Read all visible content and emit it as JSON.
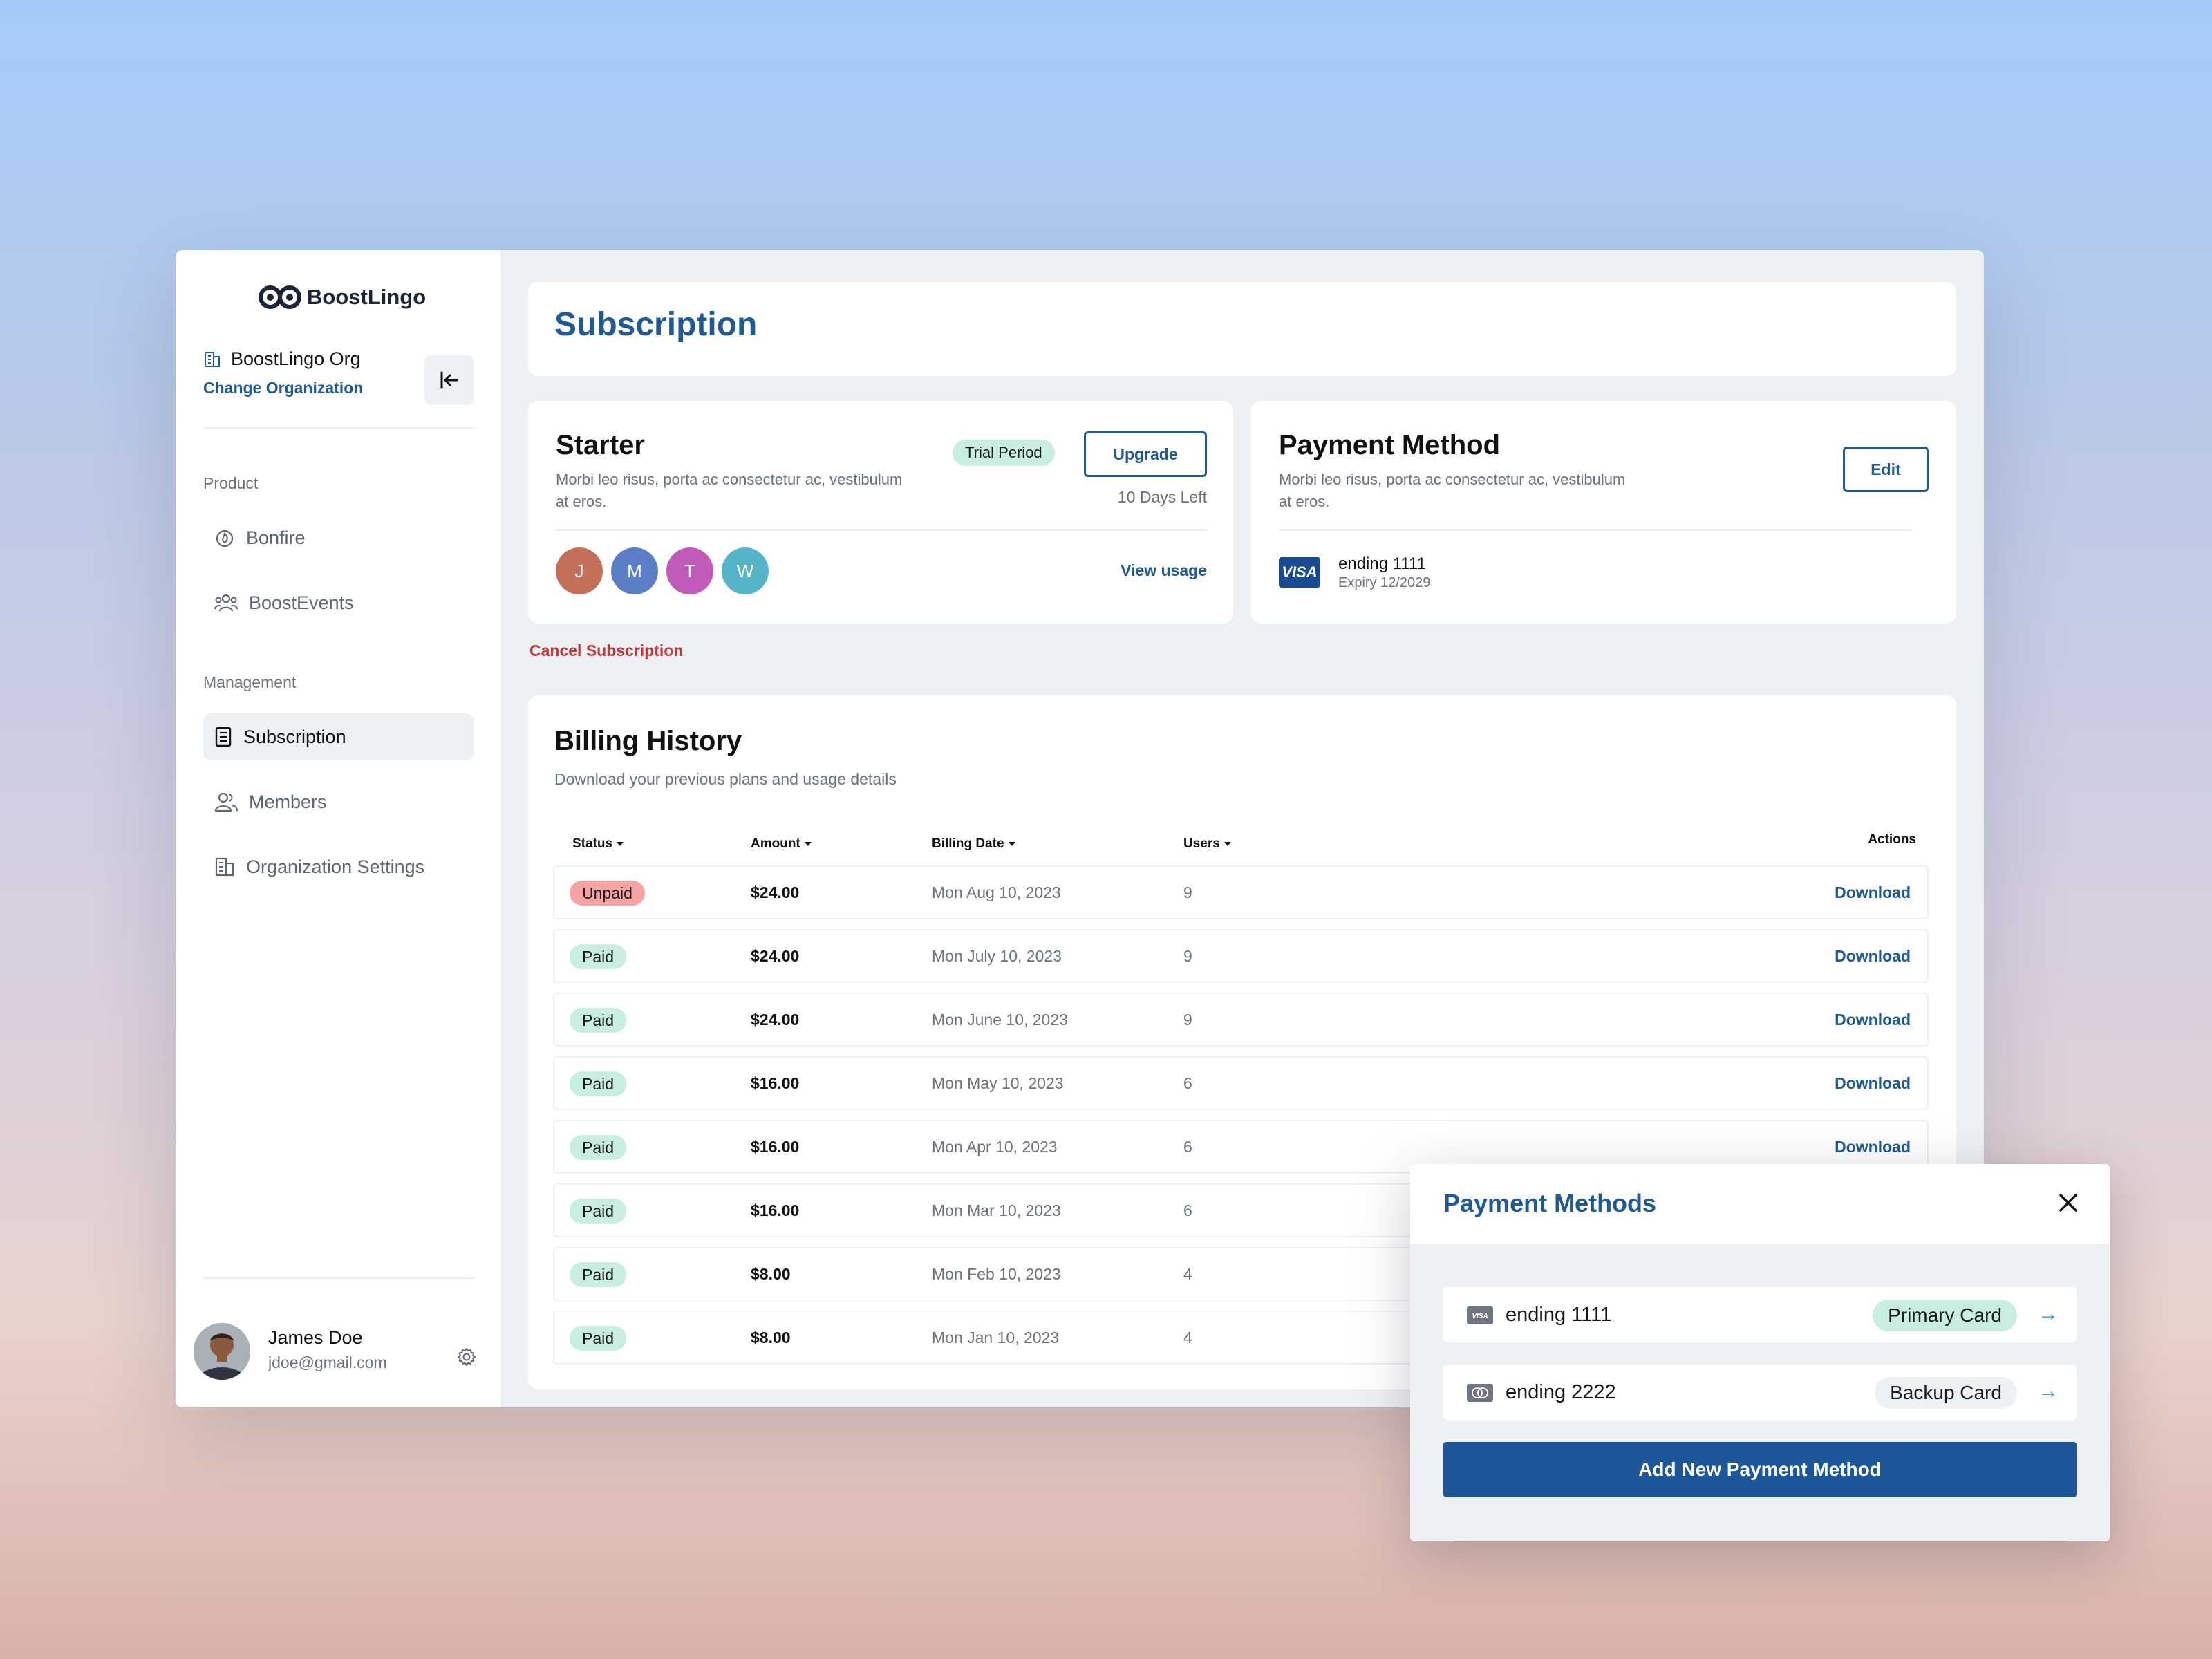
{
  "app": {
    "brand": "BoostLingo"
  },
  "org": {
    "name": "BoostLingo Org",
    "change_label": "Change Organization"
  },
  "sidebar": {
    "sections": [
      {
        "label": "Product",
        "items": [
          {
            "label": "Bonfire",
            "icon": "flame-icon"
          },
          {
            "label": "BoostEvents",
            "icon": "group-icon"
          }
        ]
      },
      {
        "label": "Management",
        "items": [
          {
            "label": "Subscription",
            "icon": "receipt-icon",
            "active": true
          },
          {
            "label": "Members",
            "icon": "users-icon"
          },
          {
            "label": "Organization Settings",
            "icon": "building-icon"
          }
        ]
      }
    ]
  },
  "user": {
    "name": "James Doe",
    "email": "jdoe@gmail.com"
  },
  "page": {
    "title": "Subscription"
  },
  "plan": {
    "title": "Starter",
    "description": "Morbi leo risus, porta ac consectetur ac, vestibulum at eros.",
    "badge": "Trial Period",
    "upgrade_label": "Upgrade",
    "days_left": "10 Days Left",
    "members": [
      {
        "initial": "J",
        "color": "#c2705a"
      },
      {
        "initial": "M",
        "color": "#5b7fc6"
      },
      {
        "initial": "T",
        "color": "#c05ab8"
      },
      {
        "initial": "W",
        "color": "#55b5c6"
      }
    ],
    "view_usage": "View usage",
    "cancel_label": "Cancel Subscription"
  },
  "payment": {
    "title": "Payment Method",
    "description": "Morbi leo risus, porta ac consectetur ac, vestibulum at eros.",
    "edit_label": "Edit",
    "card_brand": "VISA",
    "card_ending": "ending 1111",
    "card_expiry": "Expiry 12/2029"
  },
  "billing": {
    "title": "Billing History",
    "subtitle": "Download your previous plans and usage details",
    "columns": {
      "status": "Status",
      "amount": "Amount",
      "date": "Billing Date",
      "users": "Users",
      "actions": "Actions"
    },
    "rows": [
      {
        "status": "Unpaid",
        "amount": "$24.00",
        "date": "Mon Aug 10, 2023",
        "users": "9",
        "action": "Download"
      },
      {
        "status": "Paid",
        "amount": "$24.00",
        "date": "Mon July 10, 2023",
        "users": "9",
        "action": "Download"
      },
      {
        "status": "Paid",
        "amount": "$24.00",
        "date": "Mon June 10, 2023",
        "users": "9",
        "action": "Download"
      },
      {
        "status": "Paid",
        "amount": "$16.00",
        "date": "Mon May 10, 2023",
        "users": "6",
        "action": "Download"
      },
      {
        "status": "Paid",
        "amount": "$16.00",
        "date": "Mon Apr 10, 2023",
        "users": "6",
        "action": "Download"
      },
      {
        "status": "Paid",
        "amount": "$16.00",
        "date": "Mon Mar 10, 2023",
        "users": "6",
        "action": ""
      },
      {
        "status": "Paid",
        "amount": "$8.00",
        "date": "Mon Feb 10, 2023",
        "users": "4",
        "action": ""
      },
      {
        "status": "Paid",
        "amount": "$8.00",
        "date": "Mon Jan 10, 2023",
        "users": "4",
        "action": ""
      }
    ]
  },
  "modal": {
    "title": "Payment Methods",
    "methods": [
      {
        "label": "ending 1111",
        "badge": "Primary Card",
        "badge_color": "#c8eee0",
        "icon": "visa-card-icon"
      },
      {
        "label": "ending 2222",
        "badge": "Backup Card",
        "badge_color": "#eef1f4",
        "icon": "mastercard-icon"
      }
    ],
    "add_label": "Add New Payment Method"
  }
}
